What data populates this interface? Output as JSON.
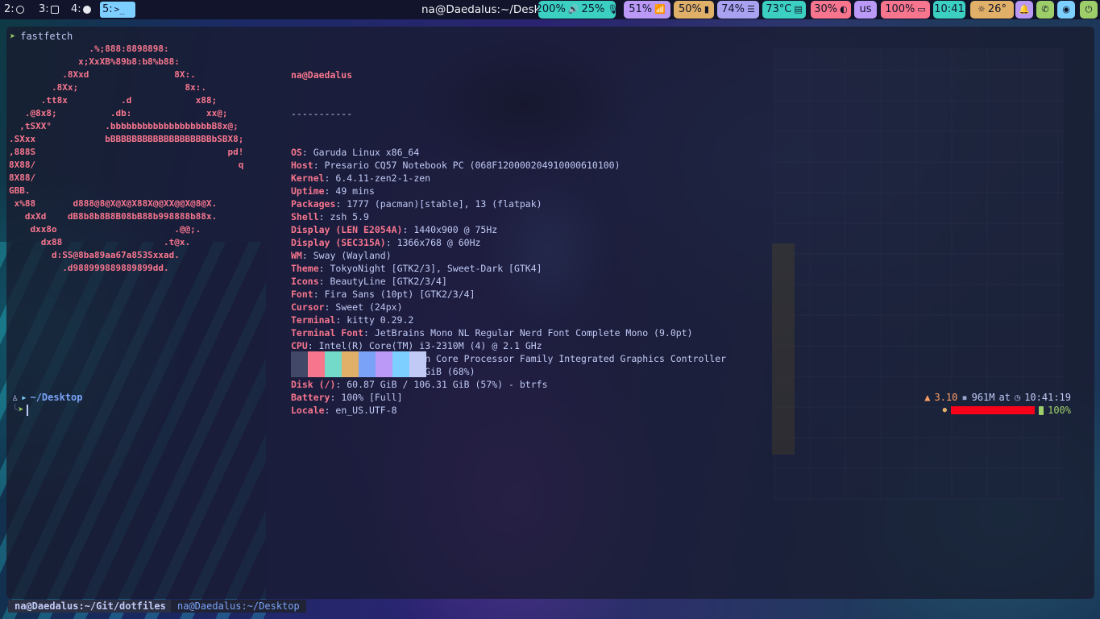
{
  "topbar": {
    "workspaces": [
      {
        "label": "2:",
        "icon": "whatsapp-icon"
      },
      {
        "label": "3:",
        "icon": "terminal-icon"
      },
      {
        "label": "4:",
        "icon": "firefox-icon"
      },
      {
        "label": "5:",
        "icon": "terminal-icon",
        "glyph": ">_"
      }
    ],
    "window_title": "na@Daedalus:~/Desktop",
    "volume": {
      "brightness": "200%",
      "volume": "25%"
    },
    "wifi": "51%",
    "battery_phone": "50%",
    "cpu": "74%",
    "temperature": "73°C",
    "backlight": "30%",
    "keyboard_layout": "us",
    "battery": "100%",
    "clock": "10:41",
    "weather": "26°",
    "colors": {
      "pill_teal": "#3bd0c2",
      "pill_purple": "#bb9af7",
      "pill_yellow": "#e0af68",
      "pill_lavender": "#a9a2f0",
      "pill_pink": "#f7768e",
      "pill_cyan": "#7dcfff"
    }
  },
  "terminal": {
    "command": "fastfetch",
    "ascii_logo": "               .%;888:8898898:\n             x;XxXB%89b8:b8%b88:\n          .8Xxd                8X:.\n        .8Xx;                    8x:.\n      .tt8x          .d            x88;\n   .@8x8;          .db:              xx@;\n  ,tSXX°          .bbbbbbbbbbbbbbbbbbbB8x@;\n.SXxx             bBBBBBBBBBBBBBBBBBBBbSBX8;\n,888S                                    pd!\n8X88/                                      q\n8X88/\nGBB.\n x%88       d888@8@X@X@X88X@@XX@@X@8@X.\n   dxXd    dB8b8b8B8B08bB88b998888b88x.\n    dxx8o                      .@@;.\n      dx88                   .t@x.\n        d:SS@8ba89aa67a853Sxxad.\n          .d988999889889899dd.",
    "info_title": "na@Daedalus",
    "info_separator": "-----------",
    "info": [
      {
        "key": "OS",
        "value": "Garuda Linux x86_64"
      },
      {
        "key": "Host",
        "value": "Presario CQ57 Notebook PC (068F120000204910000610100)"
      },
      {
        "key": "Kernel",
        "value": "6.4.11-zen2-1-zen"
      },
      {
        "key": "Uptime",
        "value": "49 mins"
      },
      {
        "key": "Packages",
        "value": "1777 (pacman)[stable], 13 (flatpak)"
      },
      {
        "key": "Shell",
        "value": "zsh 5.9"
      },
      {
        "key": "Display (LEN E2054A)",
        "value": "1440x900 @ 75Hz"
      },
      {
        "key": "Display (SEC315A)",
        "value": "1366x768 @ 60Hz"
      },
      {
        "key": "WM",
        "value": "Sway (Wayland)"
      },
      {
        "key": "Theme",
        "value": "TokyoNight [GTK2/3], Sweet-Dark [GTK4]"
      },
      {
        "key": "Icons",
        "value": "BeautyLine [GTK2/3/4]"
      },
      {
        "key": "Font",
        "value": "Fira Sans (10pt) [GTK2/3/4]"
      },
      {
        "key": "Cursor",
        "value": "Sweet (24px)"
      },
      {
        "key": "Terminal",
        "value": "kitty 0.29.2"
      },
      {
        "key": "Terminal Font",
        "value": "JetBrains Mono NL Regular Nerd Font Complete Mono (9.0pt)"
      },
      {
        "key": "CPU",
        "value": "Intel(R) Core(TM) i3-2310M (4) @ 2.1 GHz"
      },
      {
        "key": "GPU",
        "value": "Intel 2nd Generation Core Processor Family Integrated Graphics Controller"
      },
      {
        "key": "Memory",
        "value": "2.52 GiB / 3.68 GiB (68%)"
      },
      {
        "key": "Disk (/)",
        "value": "60.87 GiB / 106.31 GiB (57%) - btrfs"
      },
      {
        "key": "Battery",
        "value": "100% [Full]"
      },
      {
        "key": "Locale",
        "value": "en_US.UTF-8"
      }
    ],
    "palette": [
      "#414868",
      "#f7768e",
      "#73daca",
      "#e0af68",
      "#7aa2f7",
      "#bb9af7",
      "#7dcfff",
      "#c0caf5"
    ],
    "prompt_path": "~/Desktop",
    "right_prompt": {
      "rust_version": "3.10",
      "memory": "961M",
      "at": "at",
      "time": "10:41:19",
      "battery": "100%"
    }
  },
  "tabs": [
    {
      "label": "na@Daedalus:~/Git/dotfiles",
      "active": false
    },
    {
      "label": "na@Daedalus:~/Desktop",
      "active": true
    }
  ]
}
